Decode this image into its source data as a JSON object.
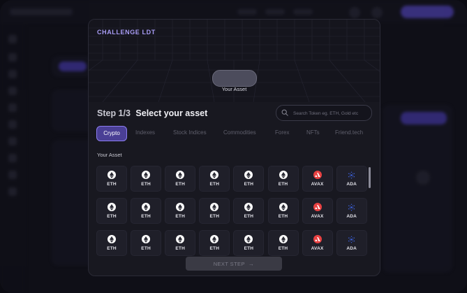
{
  "modal": {
    "title": "CHALLENGE LDT",
    "asset_caption": "Your Asset",
    "step_number": "Step 1/3",
    "step_title": "Select your asset",
    "search_placeholder": "Search Token eg. ETH, Gold etc",
    "tabs": [
      "Crypto",
      "Indexes",
      "Stock Indices",
      "Commodities",
      "Forex",
      "NFTs",
      "Friend.tech"
    ],
    "active_tab": "Crypto",
    "section_label": "Your Asset",
    "assets": [
      [
        "ETH",
        "ETH",
        "ETH",
        "ETH",
        "ETH",
        "ETH",
        "AVAX",
        "ADA"
      ],
      [
        "ETH",
        "ETH",
        "ETH",
        "ETH",
        "ETH",
        "ETH",
        "AVAX",
        "ADA"
      ],
      [
        "ETH",
        "ETH",
        "ETH",
        "ETH",
        "ETH",
        "ETH",
        "AVAX",
        "ADA"
      ]
    ],
    "next_button": "NEXT STEP",
    "next_arrow": "→"
  },
  "colors": {
    "accent": "#8c7df0",
    "active_tab_bg": "#4a3f95",
    "avax": "#e84142",
    "ada": "#2f5bd6"
  },
  "icons": {
    "eth": "ethereum-icon",
    "avax": "avalanche-icon",
    "ada": "cardano-icon",
    "search": "search-icon",
    "arrow": "arrow-right-icon"
  }
}
